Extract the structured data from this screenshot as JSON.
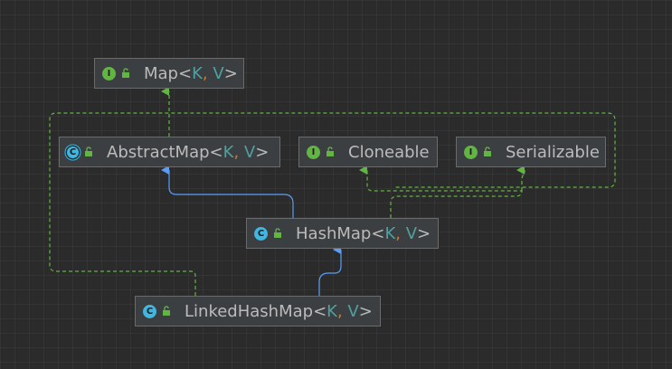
{
  "nodes": {
    "map": {
      "name": "Map",
      "params": [
        "K",
        "V"
      ],
      "badge": "I",
      "kind": "interface"
    },
    "abstract_map": {
      "name": "AbstractMap",
      "params": [
        "K",
        "V"
      ],
      "badge": "C",
      "kind": "abstract"
    },
    "cloneable": {
      "name": "Cloneable",
      "params": [],
      "badge": "I",
      "kind": "interface"
    },
    "serializable": {
      "name": "Serializable",
      "params": [],
      "badge": "I",
      "kind": "interface"
    },
    "hash_map": {
      "name": "HashMap",
      "params": [
        "K",
        "V"
      ],
      "badge": "C",
      "kind": "class"
    },
    "linked_hash_map": {
      "name": "LinkedHashMap",
      "params": [
        "K",
        "V"
      ],
      "badge": "C",
      "kind": "class"
    }
  },
  "edges": [
    {
      "from": "abstract_map",
      "to": "map",
      "type": "implements"
    },
    {
      "from": "hash_map",
      "to": "abstract_map",
      "type": "extends"
    },
    {
      "from": "hash_map",
      "to": "cloneable",
      "type": "implements"
    },
    {
      "from": "hash_map",
      "to": "serializable",
      "type": "implements"
    },
    {
      "from": "linked_hash_map",
      "to": "hash_map",
      "type": "extends"
    },
    {
      "from": "linked_hash_map",
      "to": "map",
      "type": "implements"
    }
  ],
  "colors": {
    "background": "#2b2b2b",
    "node_fill": "#3c3f41",
    "node_border": "#6b6b6b",
    "text": "#bbbbbb",
    "type_param": "#4fa1a1",
    "comma": "#cc7832",
    "extends_edge": "#589df6",
    "implements_edge": "#62b543",
    "interface_badge": "#62b543",
    "class_badge": "#40b6e0"
  },
  "icons": {
    "interface": "interface-badge-icon",
    "class": "class-badge-icon",
    "abstract": "abstract-class-badge-icon",
    "visibility": "unlocked-icon"
  }
}
